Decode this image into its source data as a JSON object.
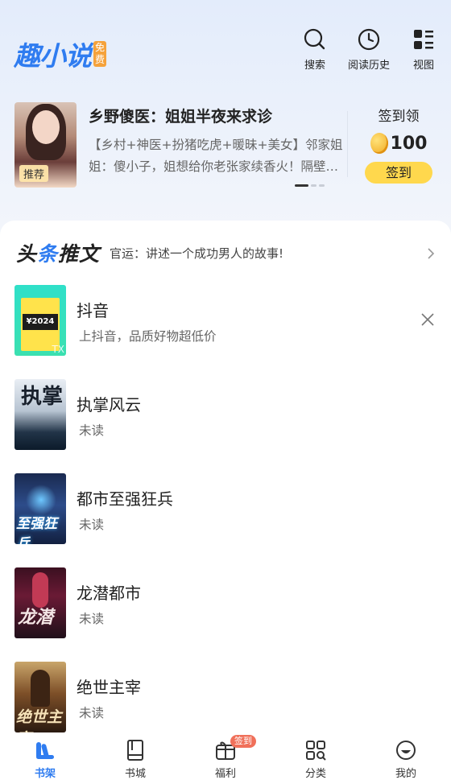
{
  "header": {
    "logo_text": "趣小说",
    "logo_badge": "免费",
    "actions": [
      {
        "label": "搜索",
        "icon": "search-icon"
      },
      {
        "label": "阅读历史",
        "icon": "clock-icon"
      },
      {
        "label": "视图",
        "icon": "grid-view-icon"
      }
    ]
  },
  "banner": {
    "cover_tag": "推荐",
    "title": "乡野傻医：姐姐半夜来求诊",
    "description": "【乡村+神医+扮猪吃虎+暖昧+美女】邻家姐姐：傻小子，姐想给你老张家续香火！隔壁…",
    "signin_label": "签到领",
    "coin_amount": "100",
    "signin_button": "签到"
  },
  "headline": {
    "logo_a": "头",
    "logo_b": "条",
    "logo_c": "推文",
    "text": "官运：讲述一个成功男人的故事!"
  },
  "books": [
    {
      "title": "抖音",
      "subtitle": "上抖音，品质好物超低价",
      "cover_text": "¥2024",
      "ad_mark": "TX"
    },
    {
      "title": "执掌风云",
      "subtitle": "未读",
      "cover_text": "执掌"
    },
    {
      "title": "都市至强狂兵",
      "subtitle": "未读",
      "cover_text": "至强狂兵"
    },
    {
      "title": "龙潜都市",
      "subtitle": "未读",
      "cover_text": "龙潜"
    },
    {
      "title": "绝世主宰",
      "subtitle": "未读",
      "cover_text": "绝世主宰"
    }
  ],
  "tabbar": {
    "tabs": [
      {
        "label": "书架",
        "icon": "bookshelf-icon",
        "active": true
      },
      {
        "label": "书城",
        "icon": "book-icon"
      },
      {
        "label": "福利",
        "icon": "gift-icon",
        "badge": "签到"
      },
      {
        "label": "分类",
        "icon": "category-icon"
      },
      {
        "label": "我的",
        "icon": "profile-icon"
      }
    ]
  },
  "colors": {
    "accent": "#2f7cf0",
    "signin_button": "#ffd84d",
    "badge": "#f0705a"
  }
}
